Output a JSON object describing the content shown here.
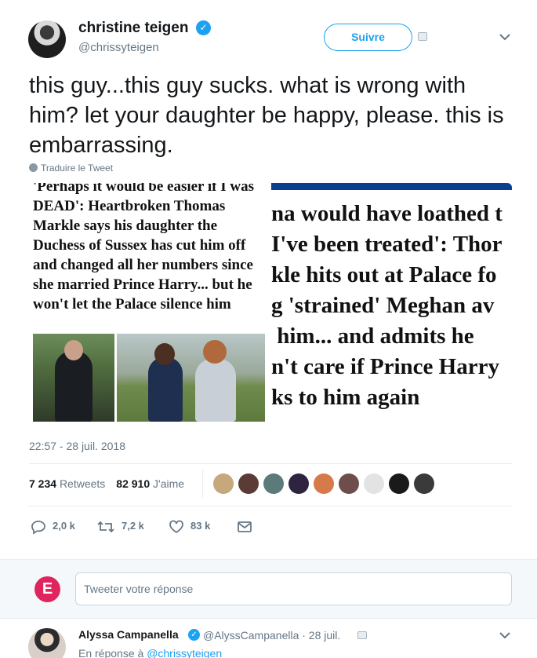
{
  "tweet": {
    "author_name": "christine teigen",
    "author_handle": "@chrissyteigen",
    "follow_label": "Suivre",
    "text": "this guy...this guy sucks. what is wrong with him? let your daughter be happy, please. this is embarrassing.",
    "translate_label": "Traduire le Tweet",
    "timestamp": "22:57 - 28 juil. 2018",
    "retweets_count": "7 234",
    "retweets_label": "Retweets",
    "likes_count": "82 910",
    "likes_label": "J'aime",
    "liker_avatars": [
      "avatar-1",
      "avatar-2",
      "avatar-3",
      "avatar-4",
      "avatar-5",
      "avatar-6",
      "avatar-7",
      "avatar-8",
      "avatar-9"
    ],
    "liker_colors": [
      "#c6a87c",
      "#5a3b36",
      "#5c7a7a",
      "#2e2440",
      "#d67a4a",
      "#6e4e4a",
      "#e3e3e3",
      "#1a1a1a",
      "#3a3a3a"
    ],
    "reply_count": "2,0 k",
    "retweet_action_count": "7,2 k",
    "like_action_count": "83 k"
  },
  "media": {
    "left_headline": "'Perhaps it would be easier if I was DEAD': Heartbroken Thomas Markle says his daughter the Duchess of Sussex has cut him off and changed all her numbers since she married Prince Harry... but he won't let the Palace silence him",
    "right_headline_lines": [
      "na would have loathed t",
      "I've been treated': Thor",
      "kle hits out at Palace fo",
      "g 'strained' Meghan av",
      " him... and admits he",
      "n't care if Prince Harry",
      "ks to him again"
    ]
  },
  "reply_box": {
    "placeholder": "Tweeter votre réponse"
  },
  "reply_tweet": {
    "author_name": "Alyssa Campanella",
    "meta": "@AlyssCampanella · 28 juil.",
    "in_reply_to_prefix": "En réponse à",
    "in_reply_to_handle": "@chrissyteigen"
  },
  "colors": {
    "accent": "#1da1f2",
    "muted": "#657786",
    "text": "#14171a",
    "news_blue": "#0a3f8f"
  },
  "icons": [
    "verified-badge-icon",
    "chevron-down-icon",
    "globe-icon",
    "reply-icon",
    "retweet-icon",
    "like-icon",
    "direct-message-icon"
  ]
}
